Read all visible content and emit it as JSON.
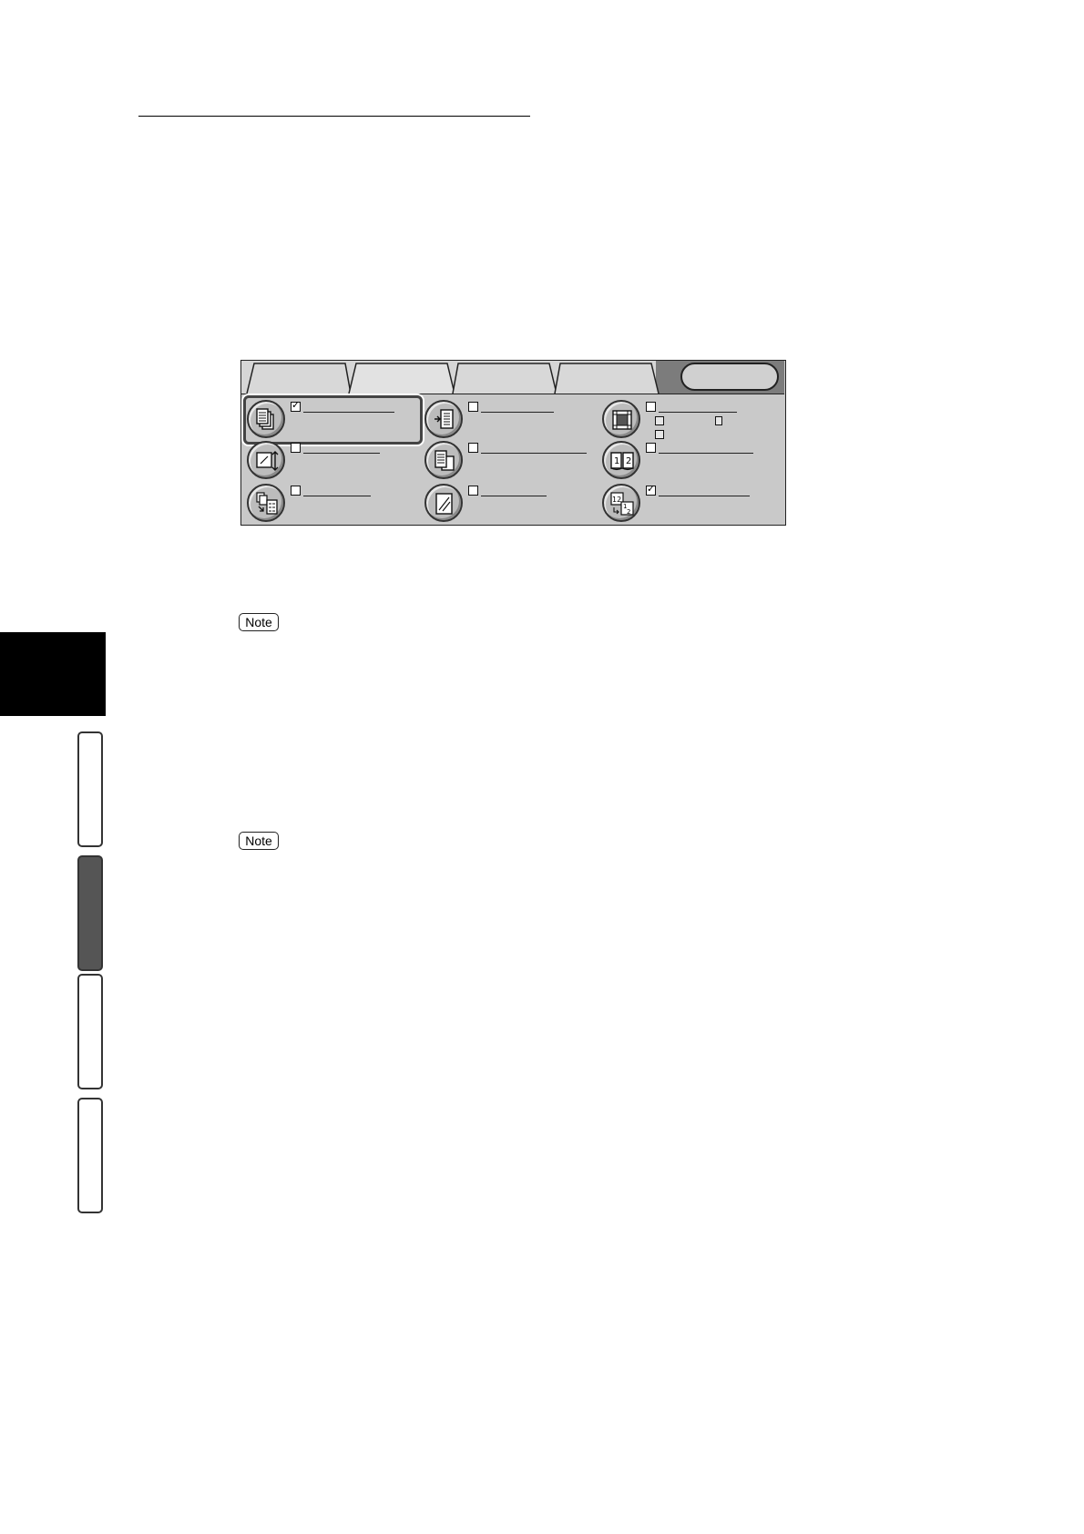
{
  "notes": [
    {
      "badge": "Note"
    },
    {
      "badge": "Note"
    }
  ],
  "panel": {
    "tabs": [
      "",
      "",
      "",
      ""
    ],
    "features": [
      {
        "id": "more-originals",
        "icon": "stacked-pages-icon",
        "checked": true
      },
      {
        "id": "margin-shift",
        "icon": "page-shift-icon",
        "checked": false
      },
      {
        "id": "edge-erase",
        "icon": "edge-erase-icon",
        "checked": false
      },
      {
        "id": "reduce-enlarge",
        "icon": "resize-arrows-icon",
        "checked": false
      },
      {
        "id": "mixed-size",
        "icon": "mixed-originals-icon",
        "checked": false
      },
      {
        "id": "book-copy",
        "icon": "open-book-icon",
        "checked": false
      },
      {
        "id": "multi-up",
        "icon": "multi-up-icon",
        "checked": false
      },
      {
        "id": "original-type",
        "icon": "original-glass-icon",
        "checked": false
      },
      {
        "id": "page-order",
        "icon": "page-order-icon",
        "checked": true
      }
    ]
  },
  "check_mark": "✓",
  "note_label": "Note",
  "colors": {
    "panel": "#c9c9c9",
    "index_active": "#555555",
    "index_black": "#000000"
  }
}
